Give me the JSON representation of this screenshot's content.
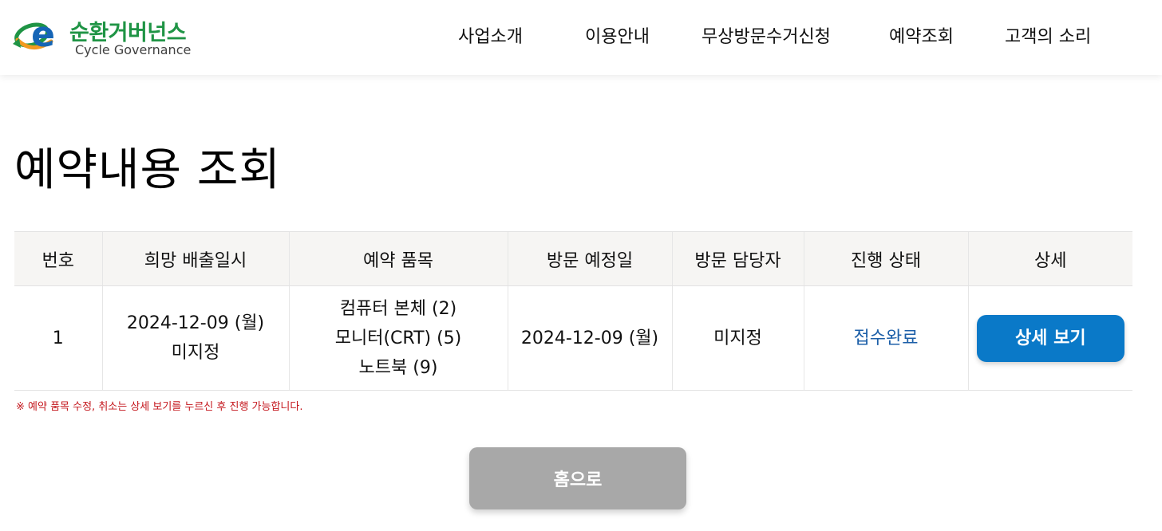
{
  "brand": {
    "name_ko": "순환거버넌스",
    "name_en": "Cycle Governance",
    "logo_letter": "e",
    "colors": {
      "green": "#1f9445",
      "blue": "#1565b6",
      "orange": "#f29a1f"
    }
  },
  "nav": {
    "items": [
      {
        "label": "사업소개"
      },
      {
        "label": "이용안내"
      },
      {
        "label": "무상방문수거신청"
      },
      {
        "label": "예약조회"
      },
      {
        "label": "고객의 소리"
      }
    ]
  },
  "page": {
    "title": "예약내용 조회"
  },
  "table": {
    "headers": [
      "번호",
      "희망 배출일시",
      "예약 품목",
      "방문 예정일",
      "방문 담당자",
      "진행 상태",
      "상세"
    ],
    "rows": [
      {
        "no": "1",
        "desired_date": "2024-12-09 (월)",
        "desired_time": "미지정",
        "items": [
          "컴퓨터 본체 (2)",
          "모니터(CRT) (5)",
          "노트북 (9)"
        ],
        "visit_date": "2024-12-09 (월)",
        "manager": "미지정",
        "status": "접수완료",
        "detail_button": "상세 보기"
      }
    ]
  },
  "notice": "※ 예약 품목 수정, 취소는 상세 보기를 누르신 후 진행 가능합니다.",
  "home_button": "홈으로",
  "colors": {
    "primary_button": "#0a79c8",
    "status_text": "#1c5fa8",
    "notice_text": "#c4161c",
    "disabled_button": "#a8a8a8",
    "table_header_bg": "#f6f5f3"
  }
}
